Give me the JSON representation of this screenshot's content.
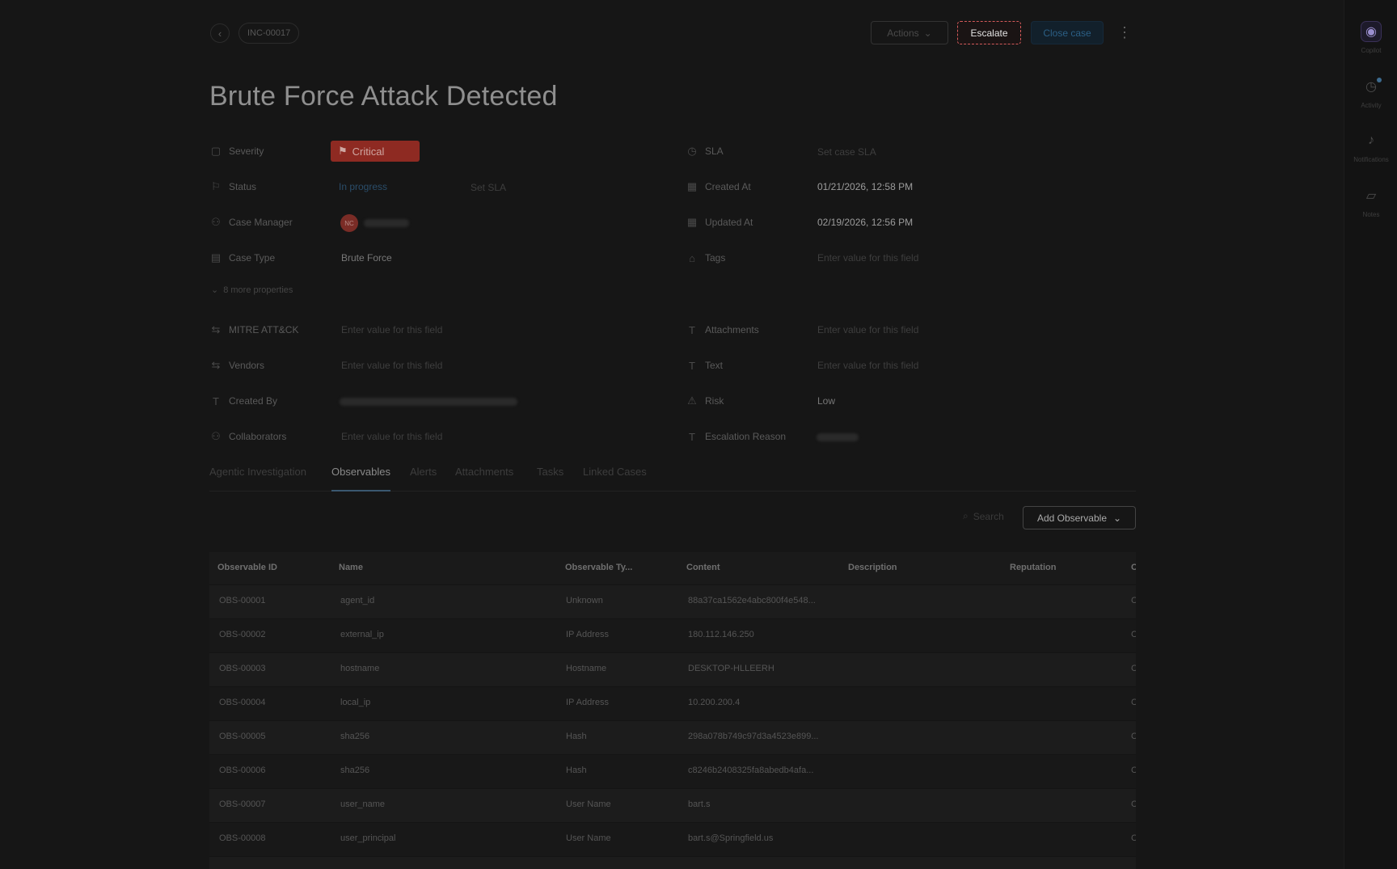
{
  "header": {
    "case_id": "INC-00017",
    "actions_label": "Actions",
    "escalate_label": "Escalate",
    "close_case_label": "Close case"
  },
  "title": "Brute Force Attack Detected",
  "properties": {
    "severity": {
      "label": "Severity",
      "value": "Critical"
    },
    "status": {
      "label": "Status",
      "value": "In progress",
      "extra": "Set SLA"
    },
    "case_manager": {
      "label": "Case Manager",
      "avatar_initials": "NC"
    },
    "case_type": {
      "label": "Case Type",
      "value": "Brute Force"
    },
    "sla": {
      "label": "SLA",
      "value": "Set case SLA"
    },
    "created_at": {
      "label": "Created At",
      "value": "01/21/2026, 12:58 PM"
    },
    "updated_at": {
      "label": "Updated At",
      "value": "02/19/2026, 12:56 PM"
    },
    "tags": {
      "label": "Tags",
      "value": "Enter value for this field"
    },
    "more": "8 more properties",
    "mitre": {
      "label": "MITRE ATT&CK",
      "value": "Enter value for this field"
    },
    "vendors": {
      "label": "Vendors",
      "value": "Enter value for this field"
    },
    "created_by": {
      "label": "Created By"
    },
    "collaborators": {
      "label": "Collaborators",
      "value": "Enter value for this field"
    },
    "attachments": {
      "label": "Attachments",
      "value": "Enter value for this field"
    },
    "text": {
      "label": "Text",
      "value": "Enter value for this field"
    },
    "risk": {
      "label": "Risk",
      "value": "Low"
    },
    "escalation_reason": {
      "label": "Escalation Reason"
    }
  },
  "tabs": [
    "Agentic Investigation",
    "Observables",
    "Alerts",
    "Attachments",
    "Tasks",
    "Linked Cases"
  ],
  "active_tab": "Observables",
  "toolbar": {
    "search_placeholder": "Search",
    "add_observable_label": "Add Observable"
  },
  "table": {
    "columns": [
      "Observable ID",
      "Name",
      "Observable Ty...",
      "Content",
      "Description",
      "Reputation",
      "C"
    ],
    "rows": [
      {
        "id": "OBS-00001",
        "name": "agent_id",
        "type": "Unknown",
        "content": "88a37ca1562e4abc800f4e548...",
        "extra": "C"
      },
      {
        "id": "OBS-00002",
        "name": "external_ip",
        "type": "IP Address",
        "content": "180.112.146.250",
        "extra": "C"
      },
      {
        "id": "OBS-00003",
        "name": "hostname",
        "type": "Hostname",
        "content": "DESKTOP-HLLEERH",
        "extra": "C"
      },
      {
        "id": "OBS-00004",
        "name": "local_ip",
        "type": "IP Address",
        "content": "10.200.200.4",
        "extra": "C"
      },
      {
        "id": "OBS-00005",
        "name": "sha256",
        "type": "Hash",
        "content": "298a078b749c97d3a4523e899...",
        "extra": "C"
      },
      {
        "id": "OBS-00006",
        "name": "sha256",
        "type": "Hash",
        "content": "c8246b2408325fa8abedb4afa...",
        "extra": "C"
      },
      {
        "id": "OBS-00007",
        "name": "user_name",
        "type": "User Name",
        "content": "bart.s",
        "extra": "C"
      },
      {
        "id": "OBS-00008",
        "name": "user_principal",
        "type": "User Name",
        "content": "bart.s@Springfield.us",
        "extra": "C"
      }
    ]
  },
  "rail": {
    "copilot": "Copilot",
    "activity": "Activity",
    "notifications": "Notifications",
    "notes": "Notes"
  },
  "colors": {
    "accent": "#3a5870",
    "critical": "#8e2a22",
    "escalate_border": "#d45a5a"
  }
}
